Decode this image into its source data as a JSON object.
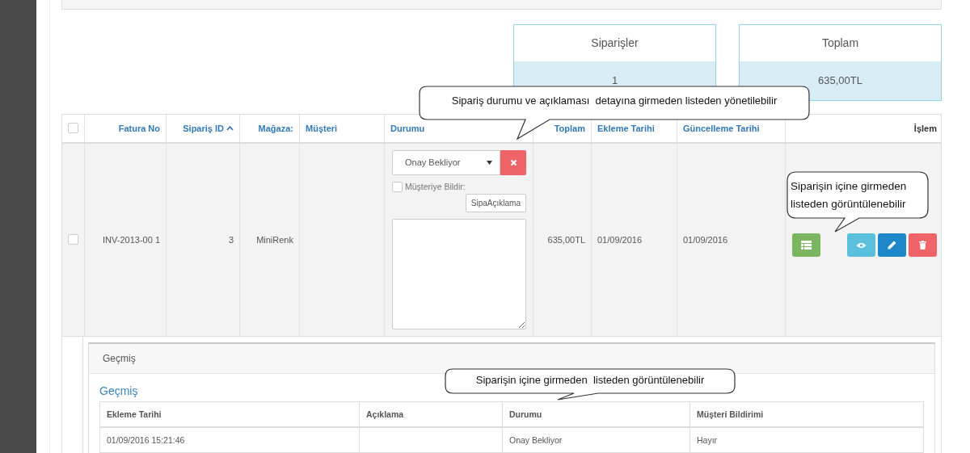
{
  "stats": [
    {
      "label": "Siparişler",
      "value": "1"
    },
    {
      "label": "Toplam",
      "value": "635,00TL"
    }
  ],
  "orders_table": {
    "select_all": {
      "checked": false
    },
    "columns": [
      {
        "label": "Fatura No",
        "link": true,
        "sorted": false
      },
      {
        "label": "Sipariş ID",
        "link": true,
        "sorted": true
      },
      {
        "label": "Mağaza:",
        "link": true,
        "sorted": false
      },
      {
        "label": "Müşteri",
        "link": true,
        "sorted": false
      },
      {
        "label": "Durumu",
        "link": true,
        "sorted": false
      },
      {
        "label": "Toplam",
        "link": true,
        "sorted": false
      },
      {
        "label": "Ekleme Tarihi",
        "link": true,
        "sorted": false
      },
      {
        "label": "Güncelleme Tarihi",
        "link": true,
        "sorted": false
      },
      {
        "label": "İşlem",
        "link": false,
        "sorted": false
      }
    ],
    "rows": [
      {
        "checked": false,
        "fatura_no": "INV-2013-00 1",
        "siparis_id": "3",
        "magaza": "MiniRenk",
        "status": {
          "value": "Onay Bekliyor",
          "notify_label": "Müşteriye Bildir:",
          "notify_checked": false,
          "button": "SipaAçıklama"
        },
        "toplam": "635,00TL",
        "ekleme_tarihi": "01/09/2016",
        "guncelleme_tarihi": "01/09/2016",
        "actions": [
          {
            "kind": "list"
          },
          {
            "kind": "view"
          },
          {
            "kind": "edit"
          },
          {
            "kind": "delete"
          }
        ]
      }
    ]
  },
  "history": {
    "panel_title": "Geçmiş",
    "link": "Geçmiş",
    "columns": [
      "Ekleme Tarihi",
      "Açıklama",
      "Durumu",
      "Müşteri Bildirimi"
    ],
    "rows": [
      [
        "01/09/2016 15:21:46",
        "",
        "Onay Bekliyor",
        "Hayır"
      ]
    ]
  },
  "callouts": [
    "Sipariş durumu ve açıklaması  detayına girmeden listeden yönetilebilir",
    "Siparişin içine girmeden listeden görüntülenebilir",
    "Siparişin içine girmeden  listeden görüntülenebilir"
  ]
}
